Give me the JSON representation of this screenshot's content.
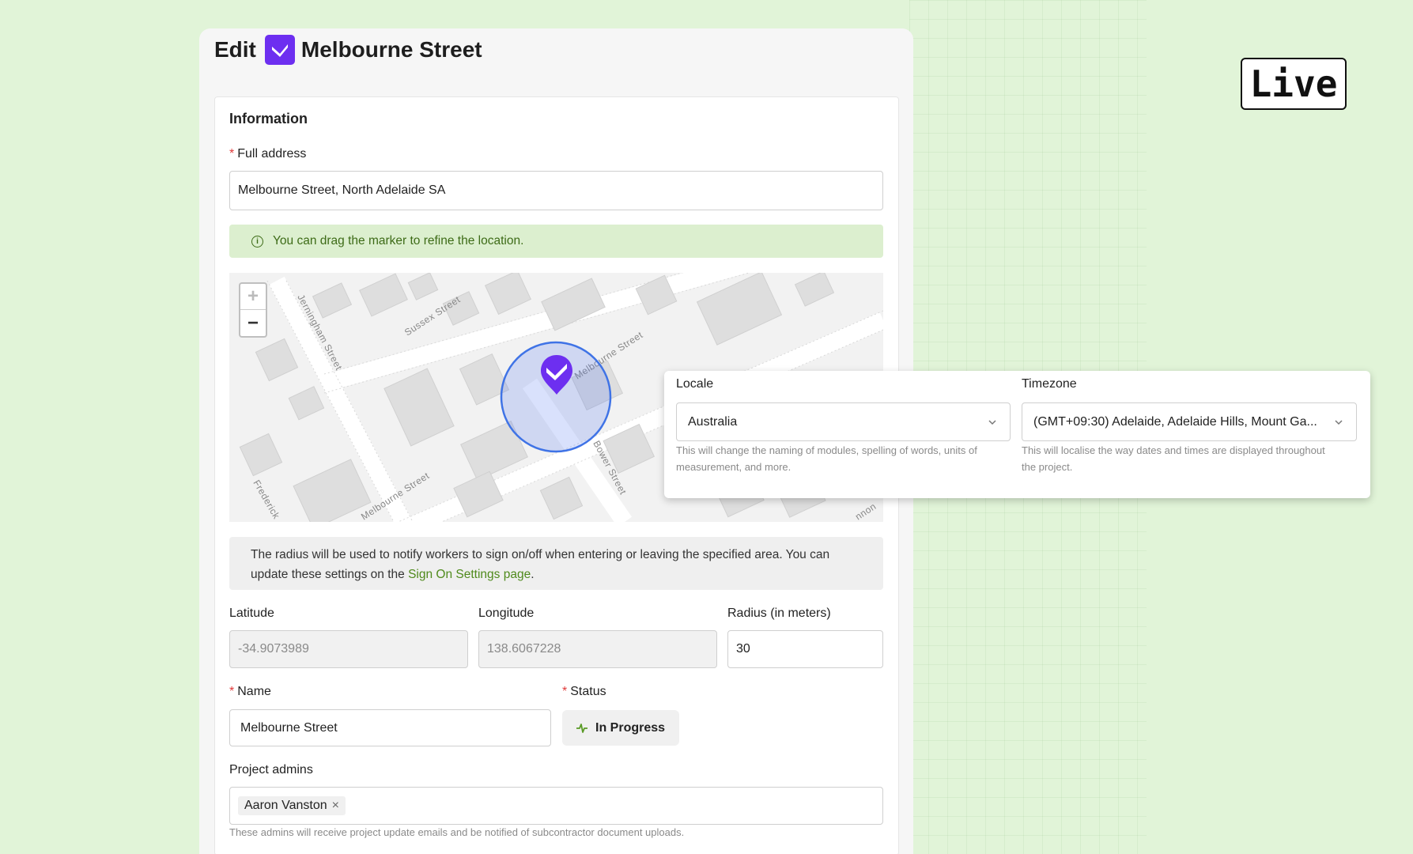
{
  "badge": {
    "text": "Live"
  },
  "header": {
    "prefix": "Edit",
    "title": "Melbourne Street"
  },
  "section": {
    "title": "Information"
  },
  "full_address": {
    "label": "Full address",
    "value": "Melbourne Street, North Adelaide SA"
  },
  "info_banner": {
    "icon": "info-icon",
    "text": "You can drag the marker to refine the location."
  },
  "map": {
    "streets": [
      "Jerningham Street",
      "Sussex Street",
      "Melbourne Street",
      "Melbourne Street",
      "Frederick",
      "Jerningham",
      "Bower Street",
      "nnon"
    ],
    "zoom_in": "+",
    "zoom_out": "−"
  },
  "radius_note": {
    "text": "The radius will be used to notify workers to sign on/off when entering or leaving the specified area. You can update these settings on the ",
    "link": "Sign On Settings page",
    "suffix": "."
  },
  "latitude": {
    "label": "Latitude",
    "value": "-34.9073989"
  },
  "longitude": {
    "label": "Longitude",
    "value": "138.6067228"
  },
  "radius": {
    "label": "Radius (in meters)",
    "value": "30"
  },
  "name": {
    "label": "Name",
    "value": "Melbourne Street"
  },
  "status": {
    "label": "Status",
    "value": "In Progress",
    "icon": "activity-icon"
  },
  "admins": {
    "label": "Project admins",
    "tags": [
      "Aaron Vanston"
    ],
    "remove": "×",
    "help": "These admins will receive project update emails and be notified of subcontractor document uploads."
  },
  "locale": {
    "label": "Locale",
    "value": "Australia",
    "help": "This will change the naming of modules, spelling of words, units of measurement, and more."
  },
  "timezone": {
    "label": "Timezone",
    "value": "(GMT+09:30) Adelaide, Adelaide Hills, Mount Ga...",
    "help": "This will localise the way dates and times are displayed throughout the project."
  },
  "colors": {
    "brand": "#6d2ff0",
    "accent": "#4f8a1c",
    "background": "#e1f4d8"
  }
}
